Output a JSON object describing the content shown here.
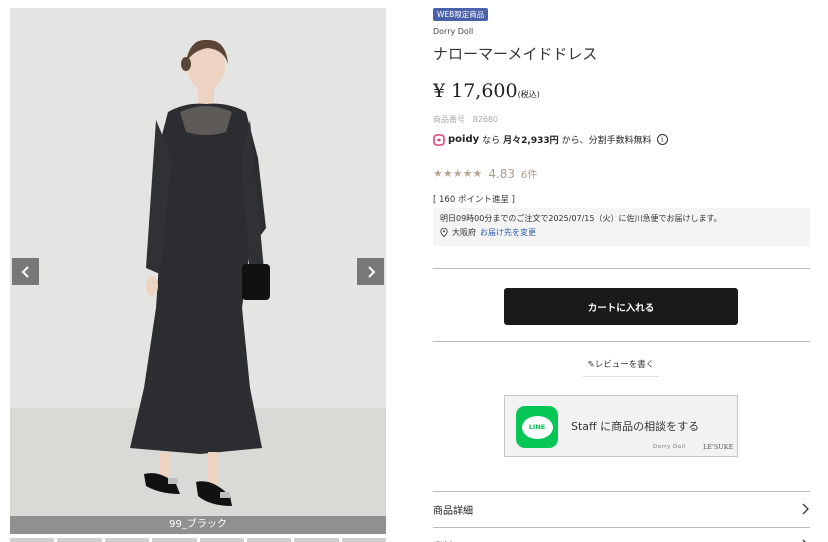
{
  "gallery": {
    "color_caption": "99_ブラック",
    "prev_icon": "chevron-left-icon",
    "next_icon": "chevron-right-icon",
    "thumbnail_count": 8
  },
  "product": {
    "badge": "WEB限定商品",
    "brand": "Dorry Doll",
    "title": "ナローマーメイドドレス",
    "price": "¥ 17,600",
    "price_tax": "(税込)",
    "product_no_label": "商品番号",
    "product_no": "82680"
  },
  "poidy": {
    "logo": "poidy",
    "prefix": "なら",
    "monthly": "月々2,933円",
    "suffix": "から、分割手数料無料",
    "info_icon": "info-icon"
  },
  "rating": {
    "stars": "★★★★★",
    "value": "4.83",
    "count": "6件"
  },
  "points": "[ 160 ポイント進呈 ]",
  "delivery": {
    "message": "明日09時00分までのご注文で2025/07/15（火）に佐川急便でお届けします。",
    "location": "大阪府",
    "change_link": "お届け先を変更"
  },
  "cart_button": "カートに入れる",
  "review_link": "レビューを書く",
  "line_banner": {
    "logo_text": "LINE",
    "main_text": "Staff に商品の相談をする",
    "sub_brand1": "Dorry Doll",
    "sub_brand2": "LE'SUKE"
  },
  "accordion": [
    {
      "label": "商品詳細"
    },
    {
      "label": "素材"
    }
  ],
  "colors": {
    "badge": "#4a63a8",
    "cart_button": "#1a1a1a",
    "line_green": "#06c755",
    "link": "#2a5db0",
    "star": "#b8a896"
  }
}
